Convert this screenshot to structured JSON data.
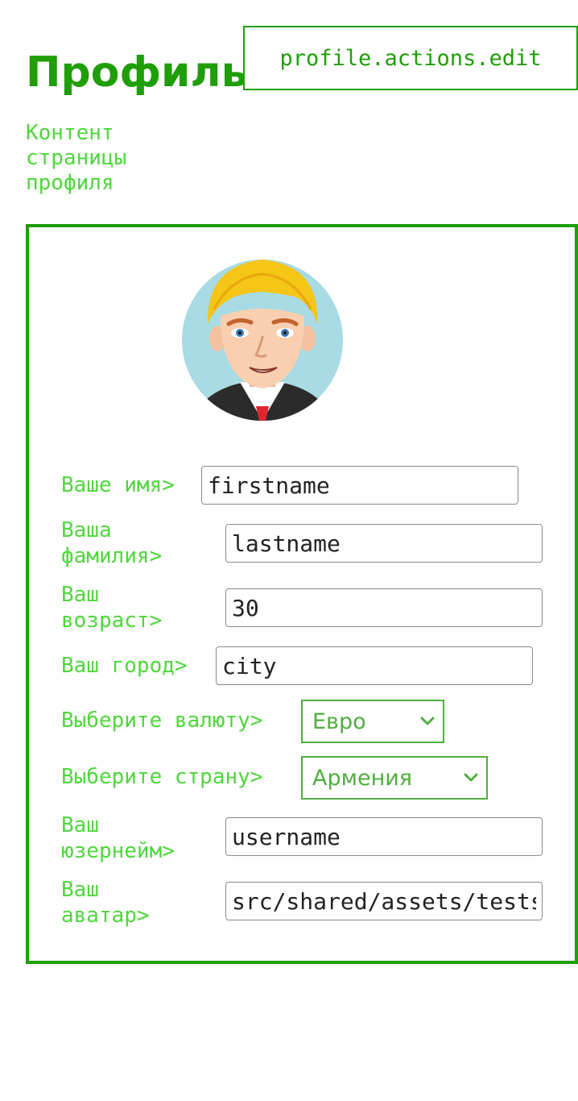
{
  "header": {
    "title": "Профиль",
    "edit_button": "profile.actions.edit",
    "subtitle": "Контент\nстраницы\nпрофиля"
  },
  "profile": {
    "avatar_alt": "avatar",
    "fields": {
      "firstname": {
        "label": "Ваше имя>",
        "value": "firstname"
      },
      "lastname": {
        "label": "Ваша\nфамилия>",
        "value": "lastname"
      },
      "age": {
        "label": "Ваш\nвозраст>",
        "value": "30"
      },
      "city": {
        "label": "Ваш город>",
        "value": "city"
      },
      "currency": {
        "label": "Выберите валюту>",
        "value": "Евро"
      },
      "country": {
        "label": "Выберите страну>",
        "value": "Армения"
      },
      "username": {
        "label": "Ваш\nюзернейм>",
        "value": "username"
      },
      "avatar": {
        "label": "Ваш\nаватар>",
        "value": "src/shared/assets/tests/storybook.jpg"
      }
    }
  },
  "colors": {
    "primary": "#1f9e08",
    "label": "#4fd73c",
    "select": "#4fae3f",
    "input_border": "#8a8a8a"
  }
}
